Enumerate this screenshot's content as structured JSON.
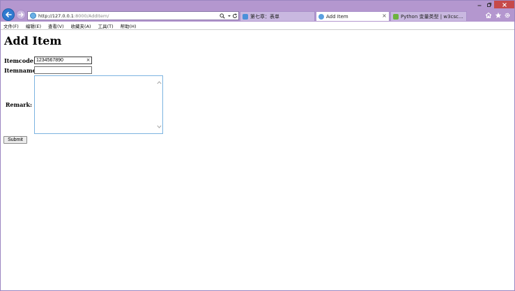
{
  "browser": {
    "address": {
      "host": "http://127.0.0.1",
      "path": ":8000/AddItem/"
    },
    "tabs": [
      {
        "label": "第七章：表单",
        "active": false,
        "favicon_color": "#4a90d9"
      },
      {
        "label": "Add Item",
        "active": true,
        "favicon_color": "#5aa0e0",
        "close_glyph": "×"
      },
      {
        "label": "Python 变量类型 | w3cschool...",
        "active": false,
        "favicon_color": "#6cb33e"
      }
    ]
  },
  "menu": [
    "文件(F)",
    "编辑(E)",
    "查看(V)",
    "收藏夹(A)",
    "工具(T)",
    "帮助(H)"
  ],
  "form": {
    "title": "Add Item",
    "itemcode_label": "Itemcode:",
    "itemcode_value": "1234567890",
    "clear_glyph": "×",
    "itemname_label": "Itemname:",
    "itemname_value": "",
    "remark_label": "Remark:",
    "remark_value": "",
    "submit_label": "Submit"
  },
  "colors": {
    "titlebar": "#b497cf",
    "close_button": "#c64a4a",
    "back_button": "#2f7ad0",
    "textarea_border": "#7bb3e0"
  },
  "icons": [
    "back-arrow",
    "forward-arrow",
    "search",
    "dropdown",
    "refresh",
    "home",
    "star",
    "gear",
    "minimize",
    "maximize",
    "close"
  ]
}
